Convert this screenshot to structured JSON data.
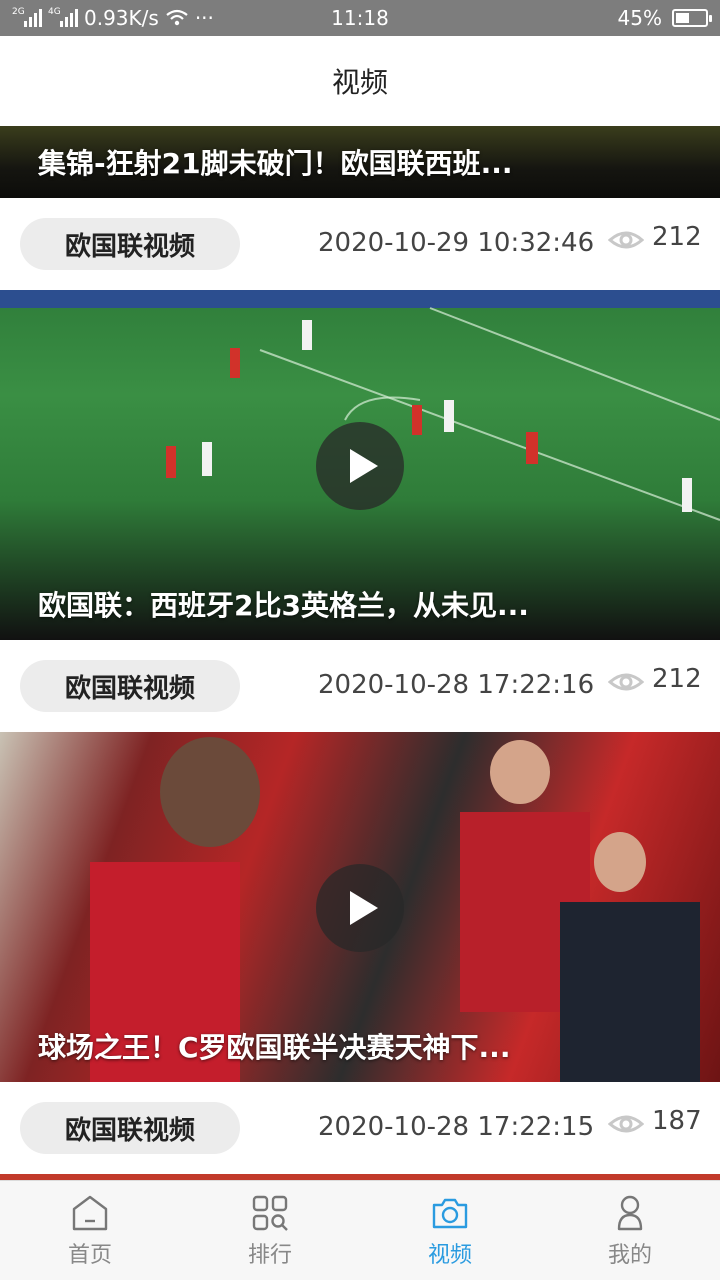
{
  "status_bar": {
    "network_left": "2G",
    "network_right": "4G",
    "speed": "0.93K/s",
    "more": "···",
    "time": "11:18",
    "battery_percent": "45%",
    "battery_level": 0.45
  },
  "header": {
    "title": "视频"
  },
  "feed": {
    "items": [
      {
        "title": "集锦-狂射21脚未破门！欧国联西班...",
        "tag": "欧国联视频",
        "date": "2020-10-29 10:32:46",
        "views": "212"
      },
      {
        "title": "欧国联：西班牙2比3英格兰，从未见...",
        "tag": "欧国联视频",
        "date": "2020-10-28 17:22:16",
        "views": "212"
      },
      {
        "title": "球场之王！C罗欧国联半决赛天神下...",
        "tag": "欧国联视频",
        "date": "2020-10-28 17:22:15",
        "views": "187"
      }
    ]
  },
  "tabbar": {
    "tabs": [
      {
        "label": "首页",
        "icon": "home-icon"
      },
      {
        "label": "排行",
        "icon": "ranking-icon"
      },
      {
        "label": "视频",
        "icon": "camera-icon",
        "active": true
      },
      {
        "label": "我的",
        "icon": "profile-icon"
      }
    ],
    "accent_color": "#2a9be0"
  }
}
